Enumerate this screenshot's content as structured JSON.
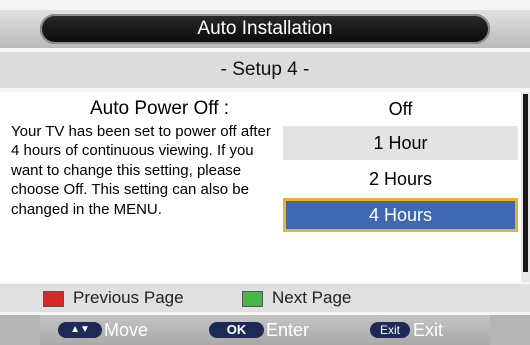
{
  "header": {
    "title": "Auto Installation"
  },
  "setup": {
    "title": "- Setup 4 -"
  },
  "setting": {
    "name": "Auto Power Off :",
    "description": "Your TV has been set to power off after 4 hours of continuous viewing. If you want to change this setting, please choose Off. This setting can also be changed in the MENU."
  },
  "options": [
    {
      "label": "Off"
    },
    {
      "label": "1 Hour"
    },
    {
      "label": "2 Hours"
    },
    {
      "label": "4 Hours",
      "selected": true
    }
  ],
  "hints": {
    "previous": {
      "label": "Previous Page",
      "color": "#d52a27"
    },
    "next": {
      "label": "Next Page",
      "color": "#47b54a"
    }
  },
  "controls": {
    "move": {
      "key": "▲▼",
      "label": "Move"
    },
    "enter": {
      "key": "OK",
      "label": "Enter"
    },
    "exit": {
      "key": "Exit",
      "label": "Exit"
    }
  },
  "colors": {
    "selected_bg": "#3f68b3",
    "selected_border": "#e8b32a"
  }
}
